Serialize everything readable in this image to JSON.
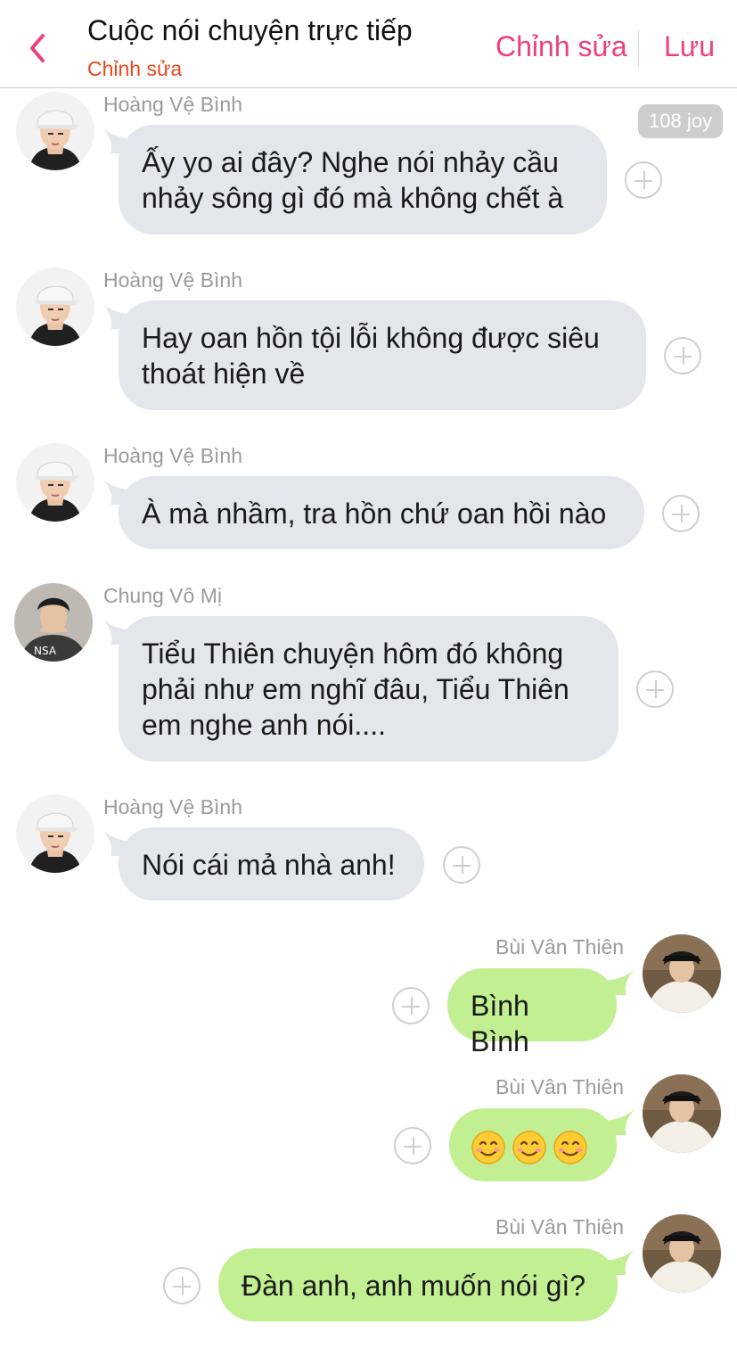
{
  "header": {
    "title": "Cuộc nói chuyện trực tiếp",
    "subtitle": "Chỉnh sửa",
    "edit_label": "Chỉnh sửa",
    "save_label": "Lưu"
  },
  "badge": "108 joy",
  "messages": [
    {
      "sender": "Hoàng Vệ Bình",
      "text": "Ấy yo ai đây? Nghe nói nhảy cầu\nnhảy sông gì đó mà không chết à"
    },
    {
      "sender": "Hoàng Vệ Bình",
      "text": "Hay oan hồn tội lỗi không được siêu\nthoát hiện về"
    },
    {
      "sender": "Hoàng Vệ Bình",
      "text": "À mà nhầm, tra hồn chứ oan hồi nào"
    },
    {
      "sender": "Chung Vô Mị",
      "text": "Tiểu Thiên chuyện hôm đó không\nphải như em nghĩ đâu, Tiểu Thiên\nem nghe anh nói...."
    },
    {
      "sender": "Hoàng Vệ Bình",
      "text": "Nói cái mả nhà anh!"
    },
    {
      "sender": "Bùi Vân Thiên",
      "text": "Bình Bình"
    },
    {
      "sender": "Bùi Vân Thiên",
      "emoji": [
        "smiling-face",
        "smiling-face",
        "smiling-face"
      ]
    },
    {
      "sender": "Bùi Vân Thiên",
      "text": "Đàn anh, anh muốn nói gì?"
    }
  ],
  "colors": {
    "accent": "#ee3f7d",
    "subtitle": "#e8461d",
    "incoming_bubble": "#e3e6ea",
    "outgoing_bubble": "#c2ef92"
  }
}
